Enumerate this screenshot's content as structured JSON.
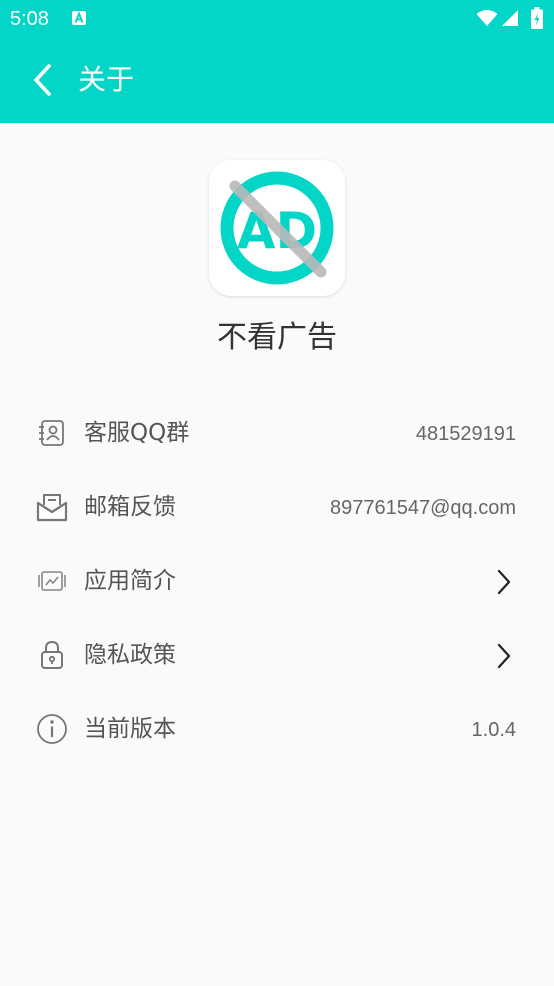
{
  "status_bar": {
    "time": "5:08",
    "notification_icon": "a-icon",
    "wifi_icon": "wifi-icon",
    "signal_icon": "signal-icon",
    "battery_icon": "battery-icon"
  },
  "toolbar": {
    "back_icon": "back-arrow-icon",
    "title": "关于"
  },
  "app": {
    "logo_icon": "no-ad-logo",
    "logo_text": "AD",
    "name": "不看广告"
  },
  "menu": [
    {
      "icon": "contact-book-icon",
      "label": "客服QQ群",
      "value": "481529191",
      "has_arrow": false
    },
    {
      "icon": "mail-icon",
      "label": "邮箱反馈",
      "value": "897761547@qq.com",
      "has_arrow": false
    },
    {
      "icon": "app-intro-icon",
      "label": "应用简介",
      "value": "",
      "has_arrow": true
    },
    {
      "icon": "lock-icon",
      "label": "隐私政策",
      "value": "",
      "has_arrow": true
    },
    {
      "icon": "info-icon",
      "label": "当前版本",
      "value": "1.0.4",
      "has_arrow": false
    }
  ],
  "colors": {
    "primary": "#03d6c6",
    "background": "#fafafa",
    "text_primary": "#333333",
    "text_secondary": "#555555",
    "text_value": "#666666",
    "icon_gray": "#777777"
  }
}
